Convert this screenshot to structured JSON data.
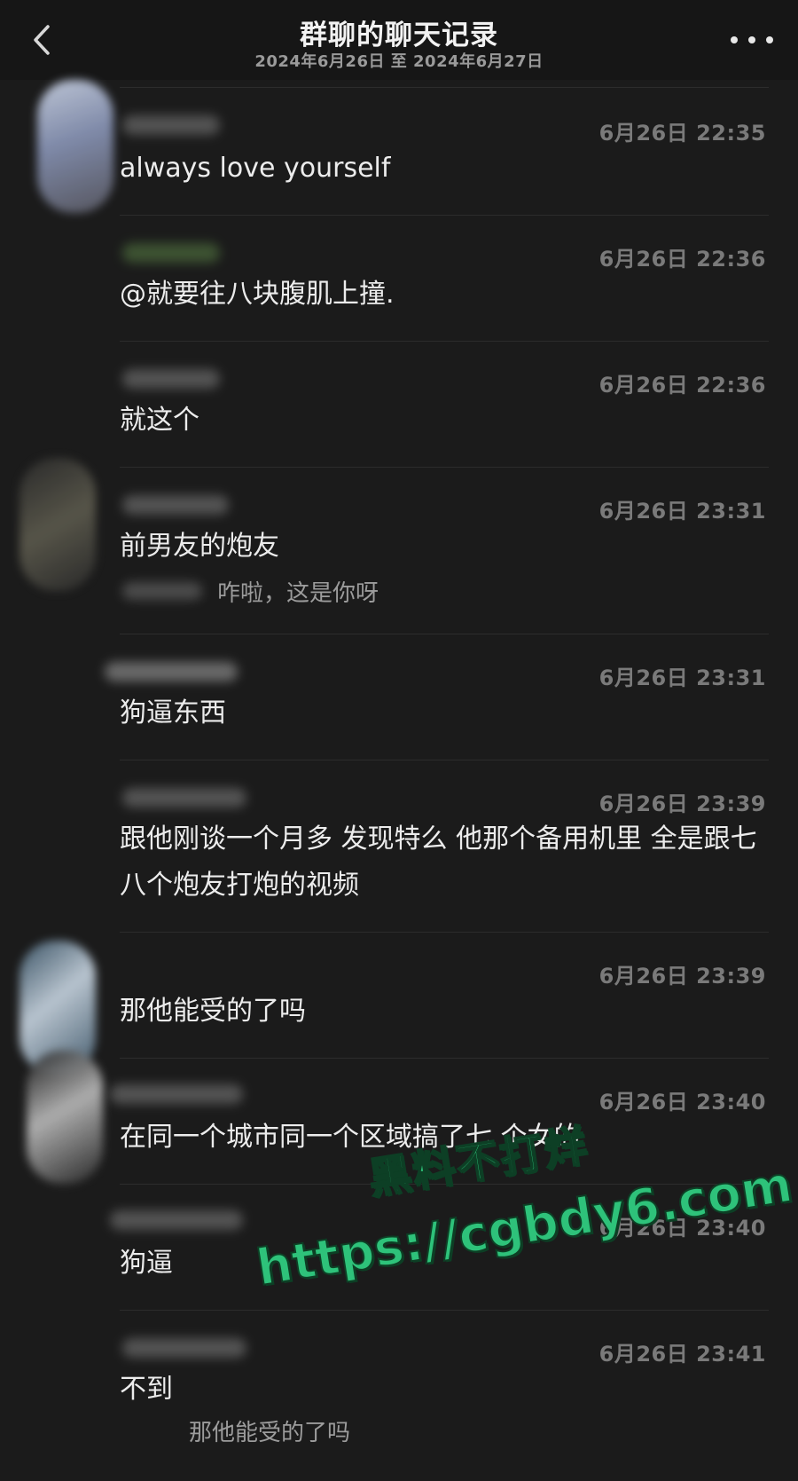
{
  "header": {
    "title": "群聊的聊天记录",
    "subtitle": "2024年6月26日 至 2024年6月27日",
    "back_icon": "chevron-left-icon",
    "more_icon": "more-horizontal-icon"
  },
  "messages": [
    {
      "time": "6月26日 22:35",
      "text": "always love yourself"
    },
    {
      "time": "6月26日 22:36",
      "text": "@就要往八块腹肌上撞."
    },
    {
      "time": "6月26日 22:36",
      "text": "就这个"
    },
    {
      "time": "6月26日 23:31",
      "text": "前男友的炮友",
      "quote": "咋啦，这是你呀"
    },
    {
      "time": "6月26日 23:31",
      "text": "狗逼东西"
    },
    {
      "time": "6月26日 23:39",
      "text": "跟他刚谈一个月多 发现特么 他那个备用机里 全是跟七八个炮友打炮的视频"
    },
    {
      "time": "6月26日 23:39",
      "text": "那他能受的了吗"
    },
    {
      "time": "6月26日 23:40",
      "text": "在同一个城市同一个区域搞了七 个女的"
    },
    {
      "time": "6月26日 23:40",
      "text": "狗逼"
    },
    {
      "time": "6月26日 23:41",
      "text": "不到",
      "quote": "那他能受的了吗"
    }
  ],
  "watermark": {
    "line1": "黑料不打烊",
    "line2": "https://cgbdy6.com"
  },
  "colors": {
    "background": "#1b1b1b",
    "header_bg": "#161616",
    "watermark": "#2ec27a"
  }
}
